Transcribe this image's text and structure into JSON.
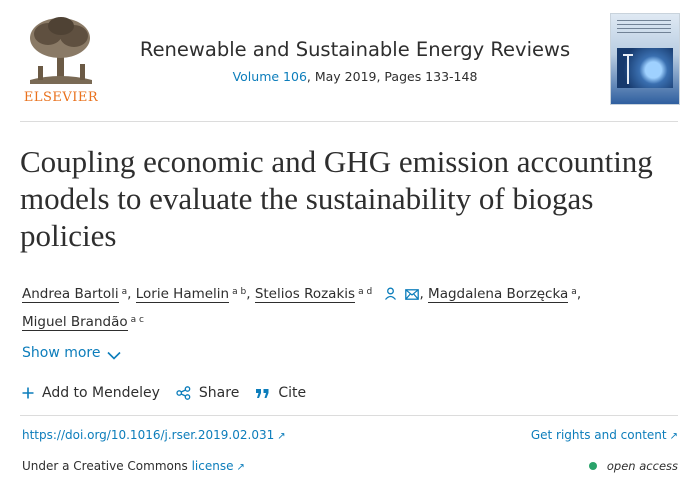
{
  "header": {
    "publisher": "ELSEVIER",
    "journal_title": "Renewable and Sustainable Energy Reviews",
    "volume": "Volume 106",
    "issue_info": ", May 2019, Pages 133-148"
  },
  "article": {
    "title": "Coupling economic and GHG emission accounting models to evaluate the sustainability of biogas policies",
    "authors": [
      {
        "name": "Andrea Bartoli",
        "sup": "a"
      },
      {
        "name": "Lorie Hamelin",
        "sup": "a b"
      },
      {
        "name": "Stelios Rozakis",
        "sup": "a d"
      },
      {
        "name": "Magdalena Borzęcka",
        "sup": "a"
      },
      {
        "name": "Miguel Brandão",
        "sup": "a c"
      }
    ]
  },
  "links": {
    "show_more": "Show more",
    "add_mendeley": "Add to Mendeley",
    "share": "Share",
    "cite": "Cite",
    "doi": "https://doi.org/10.1016/j.rser.2019.02.031",
    "rights": "Get rights and content",
    "license_prefix": "Under a Creative Commons",
    "license_link": "license",
    "open_access": "open access"
  },
  "colors": {
    "accent": "#0c7dbb",
    "brand": "#e9711c",
    "open_access": "#29a36a"
  },
  "icons": [
    "elsevier-tree-logo",
    "journal-cover",
    "person-icon",
    "envelope-icon",
    "chevron-down-icon",
    "plus-icon",
    "share-icon",
    "quote-icon",
    "external-link-icon",
    "open-access-dot"
  ]
}
